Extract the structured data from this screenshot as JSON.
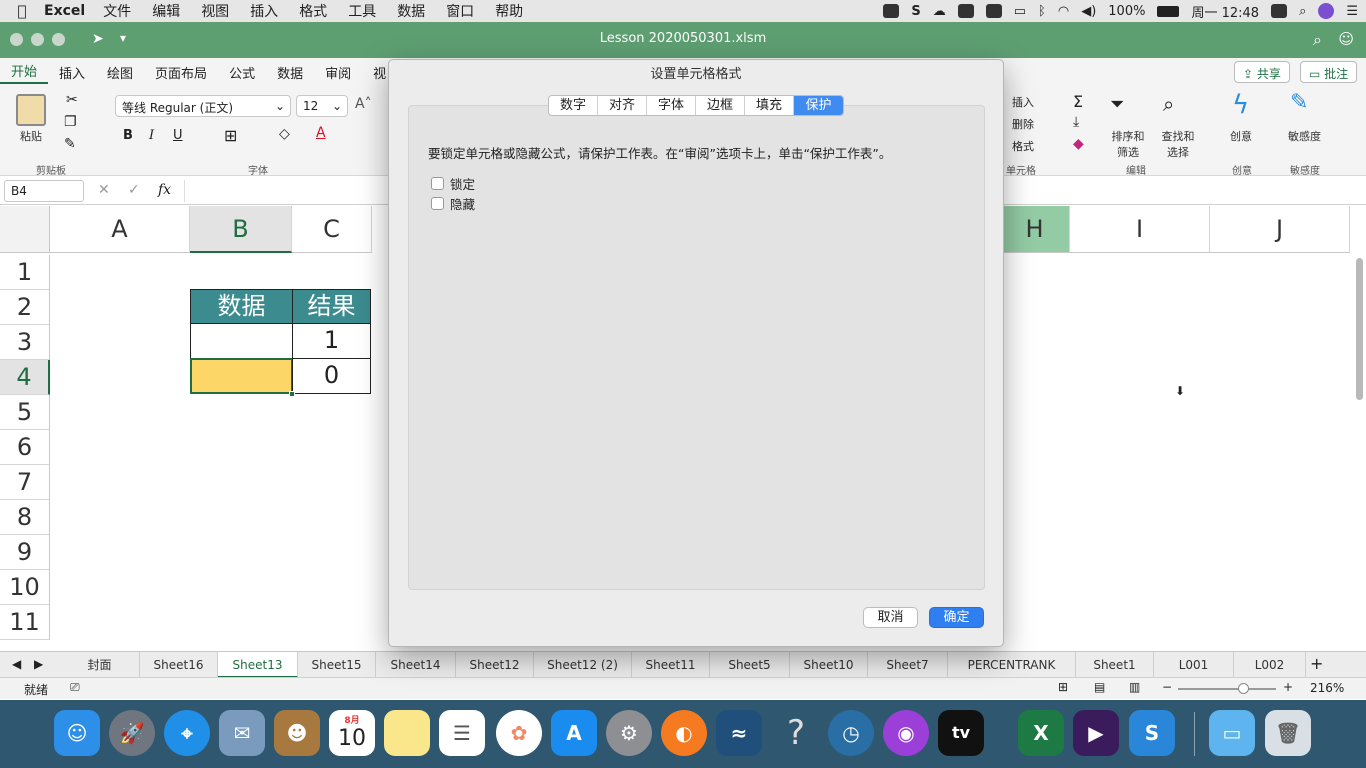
{
  "menubar": {
    "app": "Excel",
    "items": [
      "文件",
      "编辑",
      "视图",
      "插入",
      "格式",
      "工具",
      "数据",
      "窗口",
      "帮助"
    ],
    "battery": "100%",
    "clock": "周一 12:48"
  },
  "window": {
    "title": "Lesson 2020050301.xlsm"
  },
  "ribbon": {
    "tabs": [
      "开始",
      "插入",
      "绘图",
      "页面布局",
      "公式",
      "数据",
      "审阅",
      "视"
    ],
    "share": "共享",
    "comments": "批注",
    "paste": "粘贴",
    "clipboard_group": "剪贴板",
    "font_group": "字体",
    "font_name": "等线 Regular (正文)",
    "font_size": "12",
    "bold": "B",
    "italic": "I",
    "underline": "U",
    "cells_insert": "插入",
    "cells_delete": "删除",
    "cells_format": "格式",
    "cells_group": "单元格",
    "sort_filter": "排序和筛选",
    "find_select": "查找和选择",
    "edit_group": "编辑",
    "ideas": "创意",
    "ideas_group": "创意",
    "sensitivity": "敏感度",
    "sensitivity_group": "敏感度"
  },
  "formula_bar": {
    "name_box": "B4",
    "fx": "fx"
  },
  "grid": {
    "columns": [
      "A",
      "B",
      "C",
      "H",
      "I",
      "J"
    ],
    "rows": [
      "1",
      "2",
      "3",
      "4",
      "5",
      "6",
      "7",
      "8",
      "9",
      "10",
      "11"
    ],
    "header_fill": "#3b8b8f",
    "highlight_fill": "#fcd666",
    "table": {
      "h1": "数据",
      "h2": "结果",
      "c3": "1",
      "c4": "0"
    }
  },
  "sheets": [
    "封面",
    "Sheet16",
    "Sheet13",
    "Sheet15",
    "Sheet14",
    "Sheet12",
    "Sheet12 (2)",
    "Sheet11",
    "Sheet5",
    "Sheet10",
    "Sheet7",
    "PERCENTRANK",
    "Sheet1",
    "L001",
    "L002"
  ],
  "status": {
    "ready": "就绪",
    "zoom": "216%"
  },
  "dialog": {
    "title": "设置单元格格式",
    "tabs": [
      "数字",
      "对齐",
      "字体",
      "边框",
      "填充",
      "保护"
    ],
    "message": "要锁定单元格或隐藏公式，请保护工作表。在“审阅”选项卡上，单击“保护工作表”。",
    "lock_label": "锁定",
    "hide_label": "隐藏",
    "cancel": "取消",
    "ok": "确定"
  },
  "dock": {
    "calendar_month": "8月",
    "calendar_day": "10",
    "help_glyph": "?",
    "tv": "tv",
    "excel_letter": "X",
    "snagit_letter": "S"
  }
}
